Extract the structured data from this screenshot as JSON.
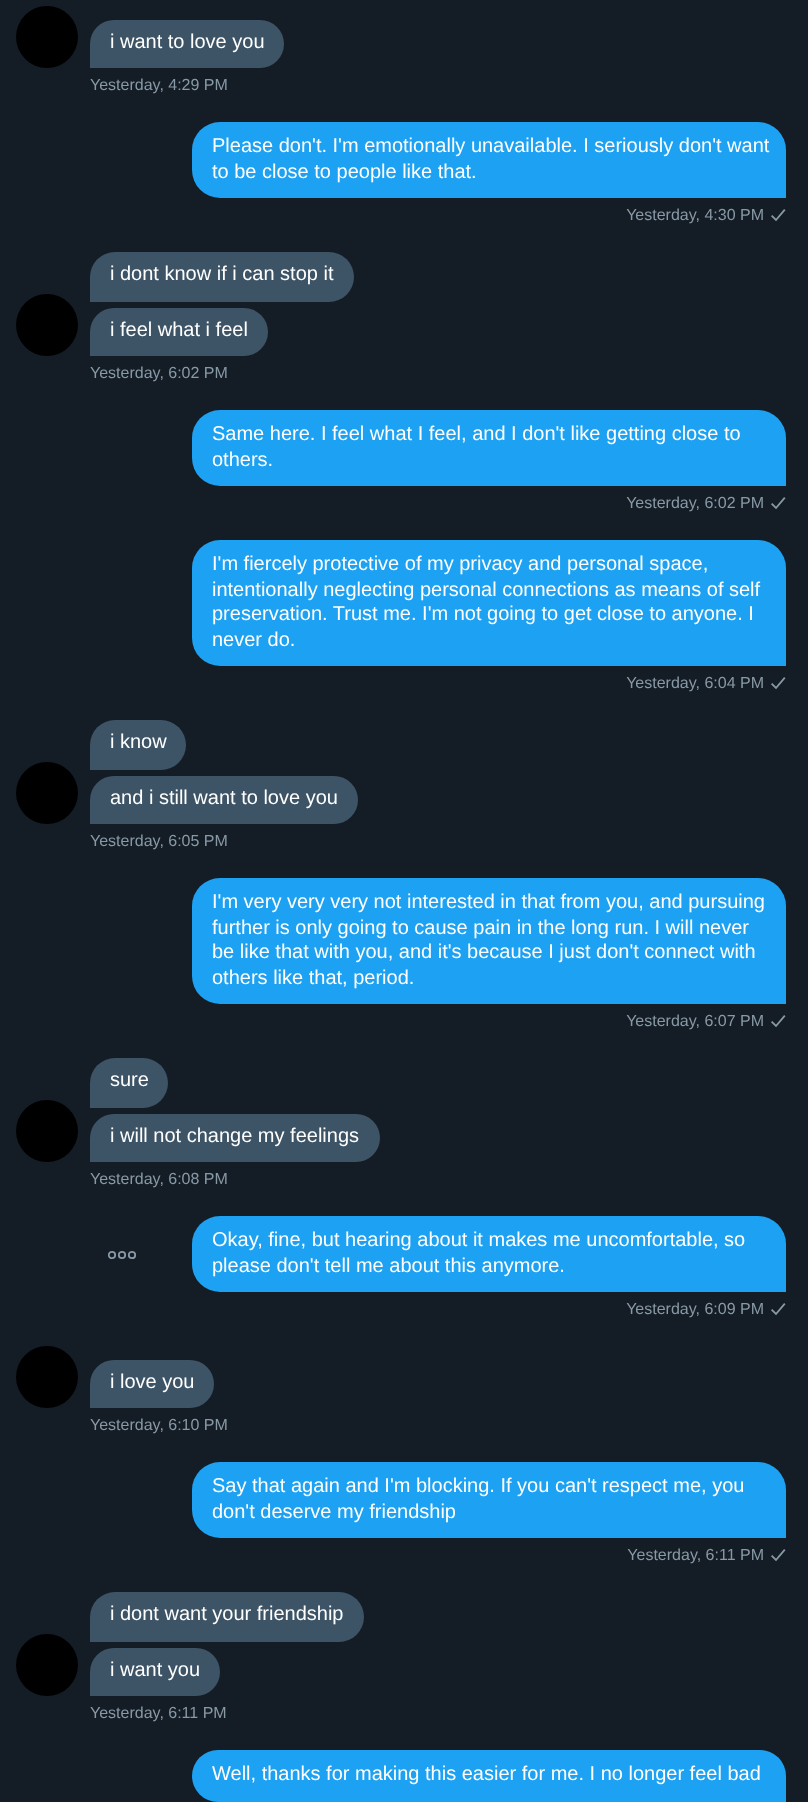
{
  "groups": [
    {
      "kind": "received",
      "messages": [
        "i want to love you"
      ],
      "time": "Yesterday, 4:29 PM",
      "show_more": false
    },
    {
      "kind": "sent",
      "messages": [
        "Please don't. I'm emotionally unavailable. I seriously don't want to be close to people like that."
      ],
      "time": "Yesterday, 4:30 PM",
      "read": true,
      "show_more": false
    },
    {
      "kind": "received",
      "messages": [
        "i dont know if i can stop it",
        "i feel what i feel"
      ],
      "time": "Yesterday, 6:02 PM",
      "show_more": false
    },
    {
      "kind": "sent",
      "messages": [
        "Same here. I feel what I feel, and I don't like getting close to others."
      ],
      "time": "Yesterday, 6:02 PM",
      "read": true,
      "show_more": false
    },
    {
      "kind": "sent",
      "messages": [
        "I'm fiercely protective of my privacy and personal space, intentionally neglecting personal connections as means of self preservation. Trust me. I'm not going to get close to anyone. I never do."
      ],
      "time": "Yesterday, 6:04 PM",
      "read": true,
      "show_more": false
    },
    {
      "kind": "received",
      "messages": [
        "i know",
        "and i still want to love you"
      ],
      "time": "Yesterday, 6:05 PM",
      "show_more": false
    },
    {
      "kind": "sent",
      "messages": [
        "I'm very very very not interested in that from you, and pursuing further is only going to cause pain in the long run. I will never be like that with you, and it's because I just don't connect with others like that, period."
      ],
      "time": "Yesterday, 6:07 PM",
      "read": true,
      "show_more": false
    },
    {
      "kind": "received",
      "messages": [
        "sure",
        "i will not change my feelings"
      ],
      "time": "Yesterday, 6:08 PM",
      "show_more": false
    },
    {
      "kind": "sent",
      "messages": [
        "Okay, fine, but hearing about it makes me uncomfortable, so please don't tell me about this anymore."
      ],
      "time": "Yesterday, 6:09 PM",
      "read": true,
      "show_more": true
    },
    {
      "kind": "received",
      "messages": [
        "i love you"
      ],
      "time": "Yesterday, 6:10 PM",
      "show_more": false
    },
    {
      "kind": "sent",
      "messages": [
        "Say that again and I'm blocking. If you can't respect me, you don't deserve my friendship"
      ],
      "time": "Yesterday, 6:11 PM",
      "read": true,
      "show_more": false
    },
    {
      "kind": "received",
      "messages": [
        "i dont want your friendship",
        "i want you"
      ],
      "time": "Yesterday, 6:11 PM",
      "show_more": false
    },
    {
      "kind": "sent",
      "messages": [
        "Well, thanks for making this easier for me. I no longer feel bad"
      ],
      "show_more": false
    }
  ]
}
